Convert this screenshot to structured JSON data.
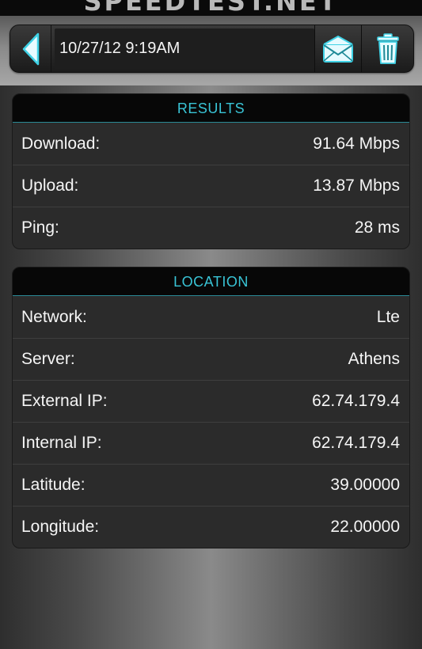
{
  "app": {
    "brand": "SPEEDTEST.NET"
  },
  "header": {
    "back_icon": "back-arrow-icon",
    "date": "10/27/12 9:19AM",
    "mail_icon": "envelope-icon",
    "trash_icon": "trash-icon",
    "accent_color": "#39c4d6"
  },
  "results": {
    "title": "RESULTS",
    "rows": [
      {
        "label": "Download:",
        "value": "91.64 Mbps"
      },
      {
        "label": "Upload:",
        "value": "13.87 Mbps"
      },
      {
        "label": "Ping:",
        "value": "28 ms"
      }
    ]
  },
  "location": {
    "title": "LOCATION",
    "rows": [
      {
        "label": "Network:",
        "value": "Lte"
      },
      {
        "label": "Server:",
        "value": "Athens"
      },
      {
        "label": "External IP:",
        "value": "62.74.179.4"
      },
      {
        "label": "Internal IP:",
        "value": "62.74.179.4"
      },
      {
        "label": "Latitude:",
        "value": "39.00000"
      },
      {
        "label": "Longitude:",
        "value": "22.00000"
      }
    ]
  }
}
